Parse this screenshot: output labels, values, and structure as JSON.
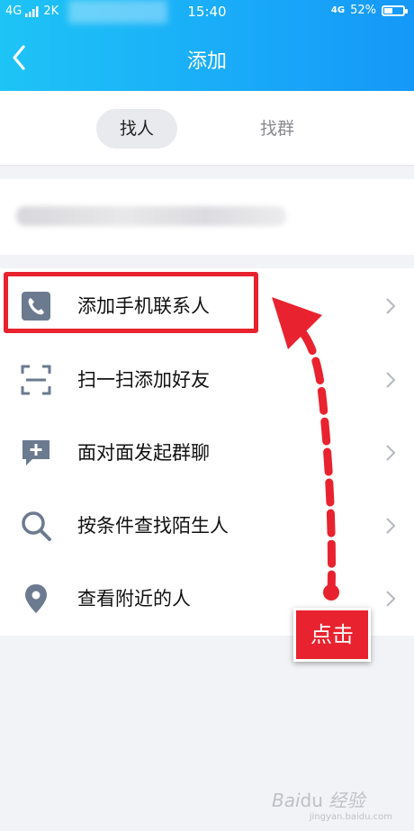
{
  "status_bar": {
    "network_left": "4G",
    "carrier": "2K",
    "time": "15:40",
    "network_right": "4G",
    "battery": "52%",
    "battery_fraction": 0.52
  },
  "header": {
    "title": "添加",
    "back_icon": "chevron-left-icon"
  },
  "tabs": [
    {
      "label": "找人",
      "active": true
    },
    {
      "label": "找群",
      "active": false
    }
  ],
  "list_items": [
    {
      "label": "添加手机联系人",
      "icon": "phone-icon"
    },
    {
      "label": "扫一扫添加好友",
      "icon": "scan-icon"
    },
    {
      "label": "面对面发起群聊",
      "icon": "chat-plus-icon"
    },
    {
      "label": "按条件查找陌生人",
      "icon": "search-icon"
    },
    {
      "label": "查看附近的人",
      "icon": "location-pin-icon"
    }
  ],
  "annotation": {
    "tap_label": "点击",
    "color": "#e8232f"
  },
  "colors": {
    "header_start": "#1ec4f6",
    "header_end": "#1598f8",
    "icon_gray": "#6b7a8f"
  }
}
